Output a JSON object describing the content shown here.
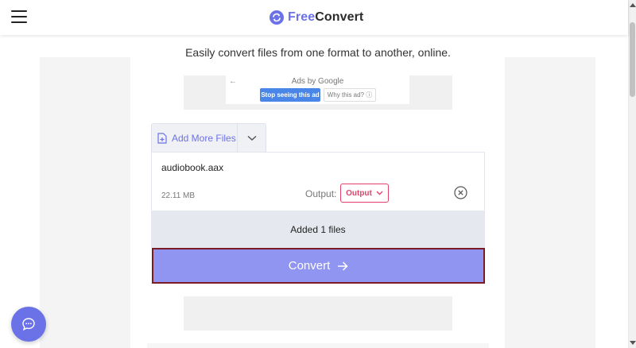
{
  "header": {
    "logo_free": "Free",
    "logo_convert": "Convert",
    "menu_icon": "hamburger-menu-icon",
    "logo_icon": "sync-arrows-icon"
  },
  "main": {
    "tagline": "Easily convert files from one format to another, online."
  },
  "ad": {
    "back_arrow": "←",
    "ads_by": "Ads by Google",
    "stop_label": "Stop seeing this ad",
    "why_label": "Why this ad? ⓘ"
  },
  "uploader": {
    "add_more_label": "Add More Files",
    "added_count_text": "Added 1 files",
    "convert_label": "Convert"
  },
  "file": {
    "name": "audiobook.aax",
    "size": "22.11 MB",
    "output_label": "Output:",
    "output_value": "Output"
  },
  "colors": {
    "brand": "#6b72e8",
    "convert_button": "#8f95f1",
    "output_accent": "#e2426b"
  }
}
